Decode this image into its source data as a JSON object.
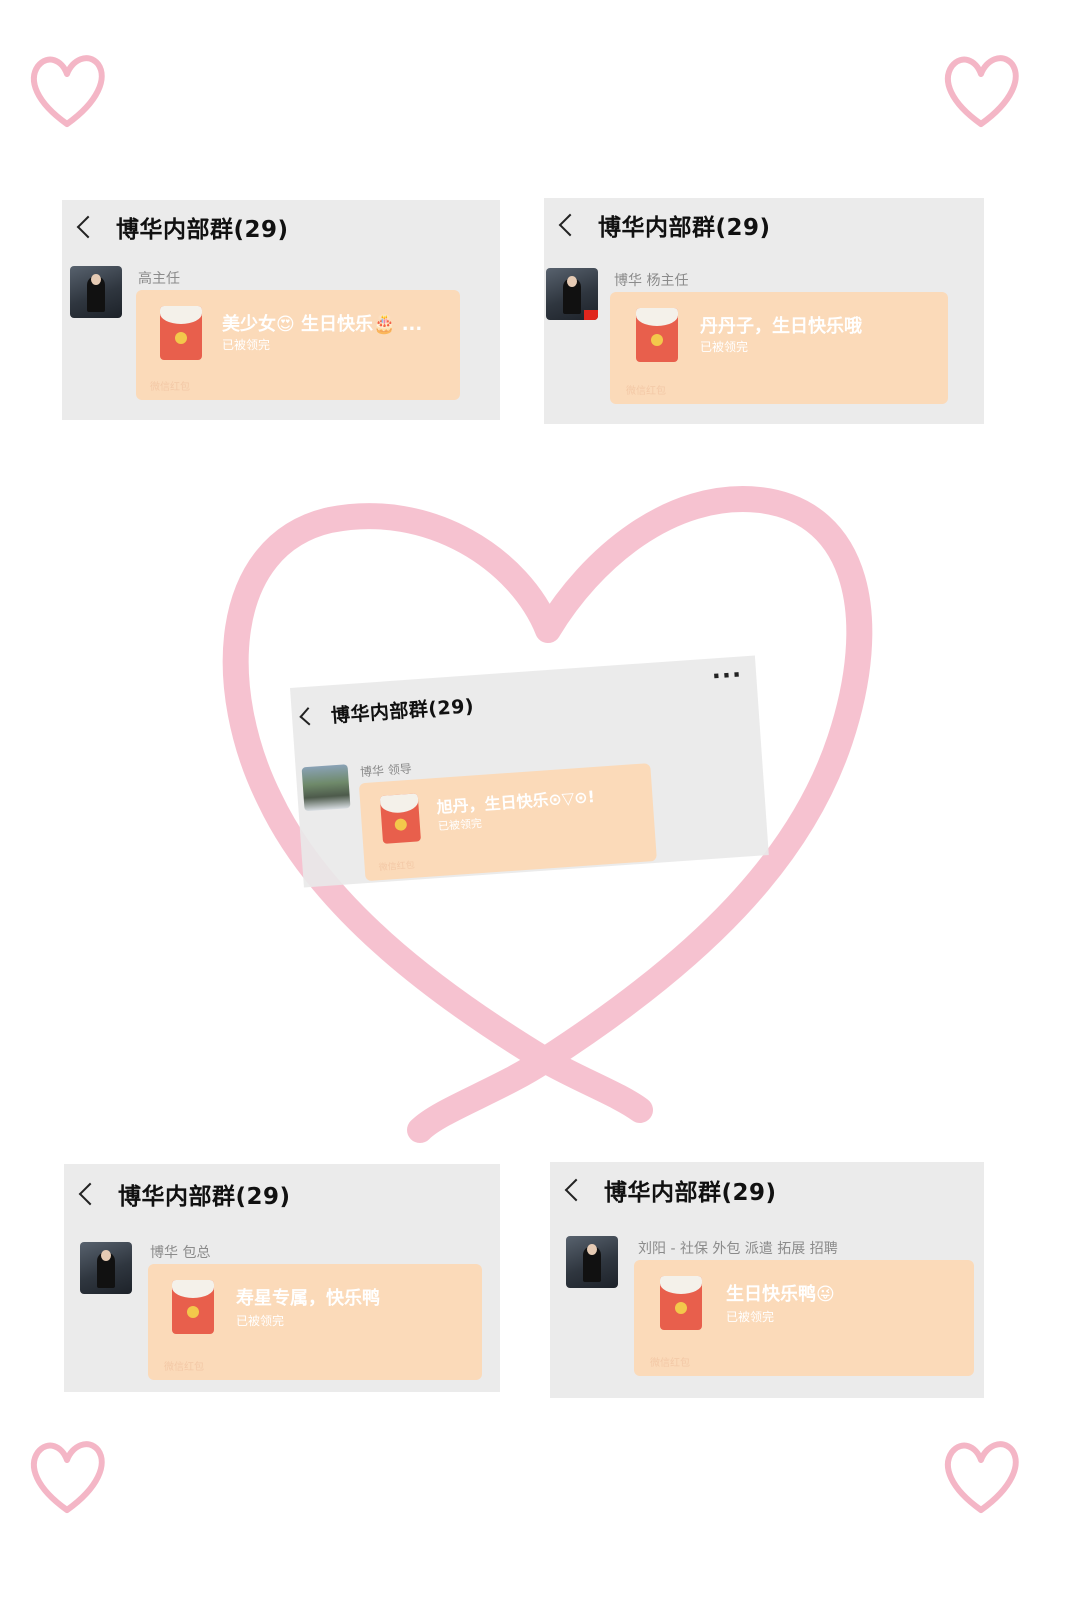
{
  "colors": {
    "background": "#ffffff",
    "heart_pink": "#f4b6c6",
    "card_gray": "#ebebeb",
    "bubble_peach": "#fbdab9",
    "envelope_red": "#e85f4c"
  },
  "icons": {
    "back": "chevron-left-icon",
    "more": "more-dots-icon",
    "heart": "heart-icon",
    "red_packet": "red-packet-icon"
  },
  "cards": [
    {
      "title": "博华内部群(29)",
      "sender": "高主任",
      "message": "美少女😍 生日快乐🎂 ...",
      "status": "已被领完",
      "footer": "微信红包"
    },
    {
      "title": "博华内部群(29)",
      "sender": "博华 杨主任",
      "message": "丹丹子，生日快乐哦",
      "status": "已被领完",
      "footer": "微信红包"
    },
    {
      "title": "博华内部群(29)",
      "more": "···",
      "sender": "博华 领导",
      "message": "旭丹，生日快乐⊙▽⊙!",
      "status": "已被领完",
      "footer": "微信红包"
    },
    {
      "title": "博华内部群(29)",
      "sender": "博华 包总",
      "message": "寿星专属，快乐鸭",
      "status": "已被领完",
      "footer": "微信红包"
    },
    {
      "title": "博华内部群(29)",
      "sender": "刘阳 - 社保 外包 派遣 拓展 招聘",
      "message": "生日快乐鸭😜",
      "status": "已被领完",
      "footer": "微信红包"
    }
  ]
}
